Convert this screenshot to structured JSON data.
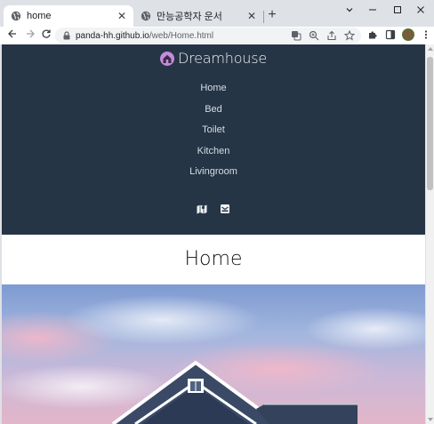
{
  "browser": {
    "tabs": [
      {
        "title": "home",
        "active": true
      },
      {
        "title": "만능공학자 운서",
        "active": false
      }
    ],
    "url": {
      "host": "panda-hh.github.io",
      "path": "/web/Home.html"
    }
  },
  "site": {
    "brand": "Dreamhouse",
    "menu": [
      "Home",
      "Bed",
      "Toilet",
      "Kitchen",
      "Livingroom"
    ],
    "social_icons": [
      "map-icon",
      "mail-icon"
    ],
    "page_title": "Home"
  },
  "colors": {
    "header_bg": "#263545",
    "sky_top": "#7e9ad1",
    "sky_pink": "#e7a9c2",
    "roof": "#3a4a66"
  }
}
